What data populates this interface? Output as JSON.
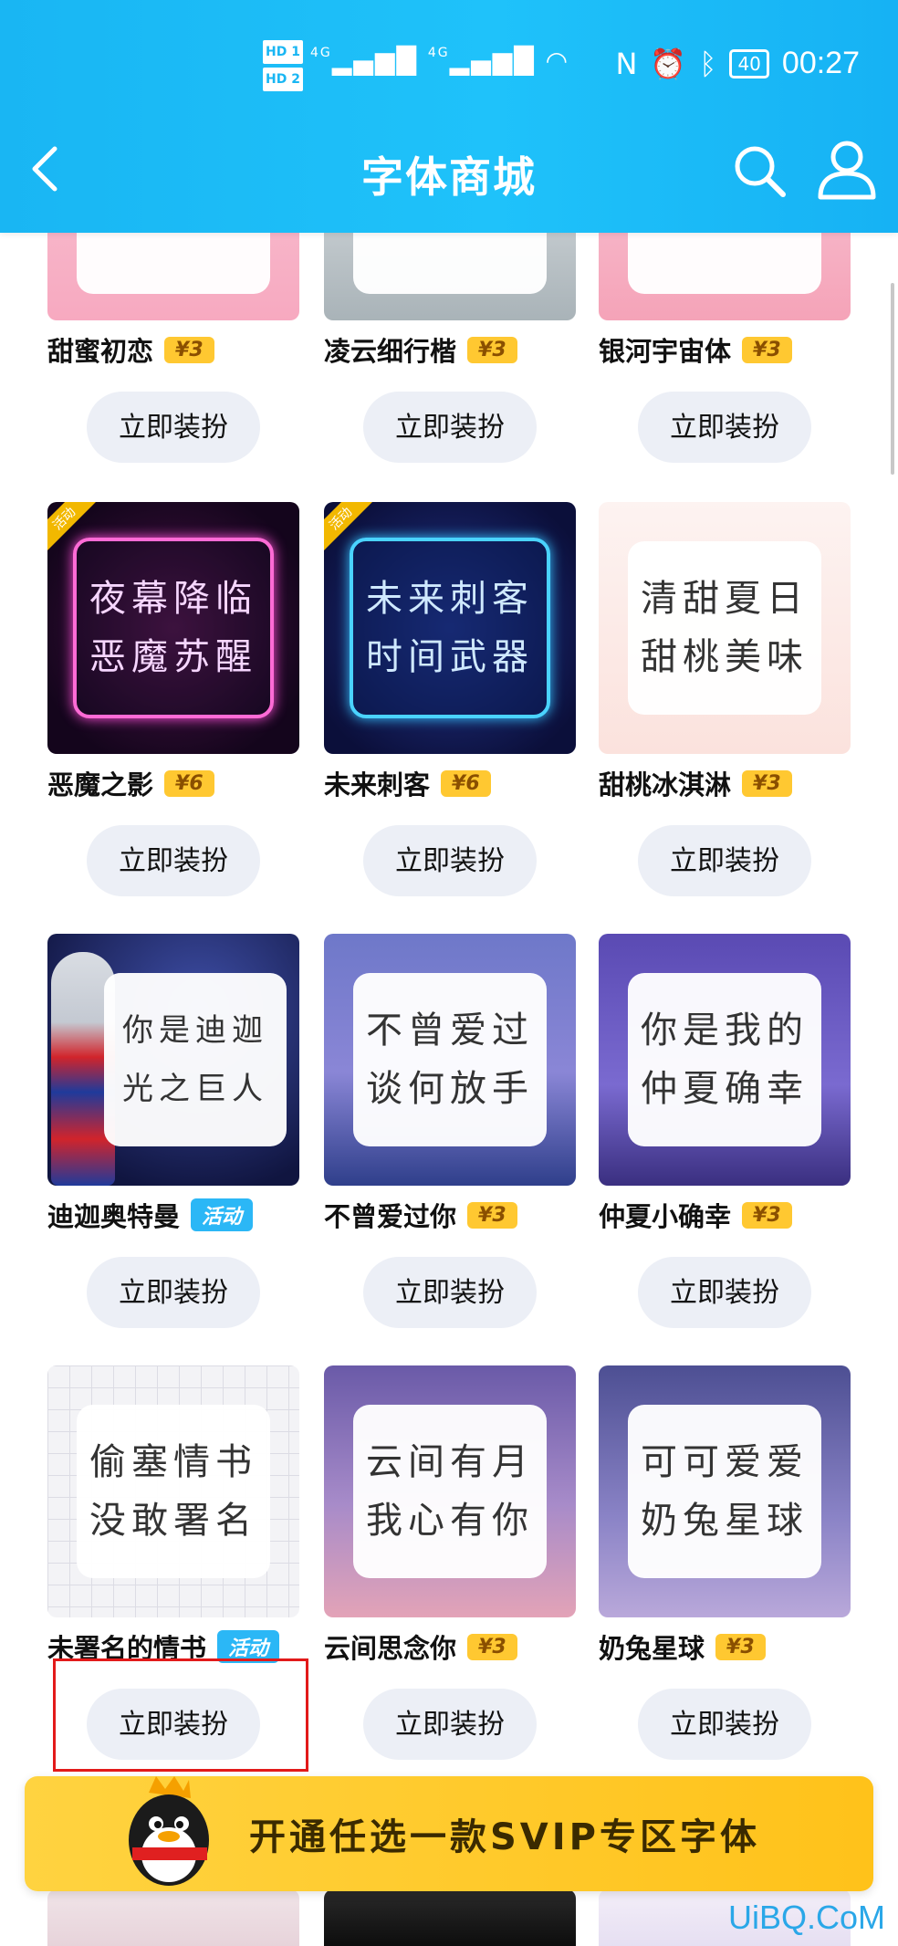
{
  "status_bar": {
    "hd1": "HD 1",
    "hd2": "HD 2",
    "net1": "4G",
    "net2": "4G",
    "battery": "40",
    "time": "00:27"
  },
  "header": {
    "title": "字体商城"
  },
  "colors": {
    "accent": "#19b6f3",
    "price": "#ffc831",
    "tag": "#2bb7f6",
    "button_bg": "#eceff6",
    "svip": "#ffc21a",
    "highlight": "#e21a1a"
  },
  "items": [
    {
      "name": "甜蜜初恋",
      "price": "¥3",
      "text1": "",
      "text2": "",
      "button": "立即装扮"
    },
    {
      "name": "凌云细行楷",
      "price": "¥3",
      "text1": "",
      "text2": "",
      "button": "立即装扮"
    },
    {
      "name": "银河宇宙体",
      "price": "¥3",
      "text1": "",
      "text2": "",
      "button": "立即装扮"
    },
    {
      "name": "恶魔之影",
      "price": "¥6",
      "text1": "夜幕降临",
      "text2": "恶魔苏醒",
      "corner": "活动",
      "button": "立即装扮"
    },
    {
      "name": "未来刺客",
      "price": "¥6",
      "text1": "未来刺客",
      "text2": "时间武器",
      "corner": "活动",
      "button": "立即装扮"
    },
    {
      "name": "甜桃冰淇淋",
      "price": "¥3",
      "text1": "清甜夏日",
      "text2": "甜桃美味",
      "button": "立即装扮"
    },
    {
      "name": "迪迦奥特曼",
      "tag": "活动",
      "text1": "你是迪迦",
      "text2": "光之巨人",
      "button": "立即装扮"
    },
    {
      "name": "不曾爱过你",
      "price": "¥3",
      "text1": "不曾爱过",
      "text2": "谈何放手",
      "button": "立即装扮"
    },
    {
      "name": "仲夏小确幸",
      "price": "¥3",
      "text1": "你是我的",
      "text2": "仲夏确幸",
      "button": "立即装扮"
    },
    {
      "name": "未署名的情书",
      "tag": "活动",
      "text1": "偷塞情书",
      "text2": "没敢署名",
      "button": "立即装扮"
    },
    {
      "name": "云间思念你",
      "price": "¥3",
      "text1": "云间有月",
      "text2": "我心有你",
      "button": "立即装扮"
    },
    {
      "name": "奶兔星球",
      "price": "¥3",
      "text1": "可可爱爱",
      "text2": "奶兔星球",
      "button": "立即装扮"
    }
  ],
  "svip_banner": {
    "label": "开通任选一款SVIP专区字体"
  },
  "watermark": "UiBQ.CoM"
}
